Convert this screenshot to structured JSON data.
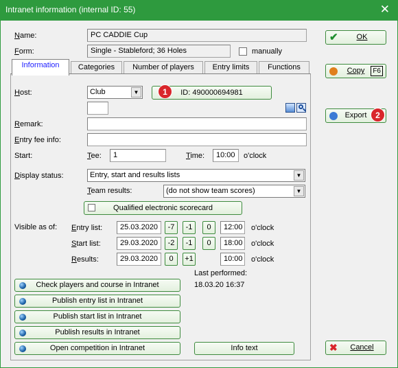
{
  "window": {
    "title": "Intranet information (internal ID: 55)",
    "close_glyph": "✕"
  },
  "header": {
    "name_label": "Name:",
    "name_value": "PC CADDIE Cup",
    "form_label": "Form:",
    "form_value": "Single - Stableford; 36 Holes",
    "manually_label": "manually"
  },
  "tabs": [
    "Information",
    "Categories",
    "Number of players",
    "Entry limits",
    "Functions"
  ],
  "info": {
    "host_label": "Host:",
    "host_value": "Club",
    "id_button": "ID: 490000694981",
    "remark_label": "Remark:",
    "entry_fee_label": "Entry fee info:",
    "start_label": "Start:",
    "tee_label": "Tee:",
    "tee_value": "1",
    "time_label": "Time:",
    "time_value": "10:00",
    "oclock": "o'clock",
    "display_status_label": "Display status:",
    "display_status_value": "Entry, start and results lists",
    "team_results_label": "Team results:",
    "team_results_value": "(do not show team scores)",
    "qualified_label": "Qualified electronic scorecard",
    "visible_as_of_label": "Visible as of:",
    "entry_list": {
      "label": "Entry list:",
      "date": "25.03.2020",
      "btns": [
        "-7",
        "-1",
        "0"
      ],
      "time": "12:00"
    },
    "start_list": {
      "label": "Start list:",
      "date": "29.03.2020",
      "btns": [
        "-2",
        "-1",
        "0"
      ],
      "time": "18:00"
    },
    "results": {
      "label": "Results:",
      "date": "29.03.2020",
      "btns": [
        "0",
        "+1"
      ],
      "time": "10:00"
    },
    "last_performed_label": "Last performed:",
    "last_performed_value": "18.03.20 16:37",
    "actions": [
      "Check players and course in Intranet",
      "Publish entry list in Intranet",
      "Publish start list in Intranet",
      "Publish results in Intranet",
      "Open competition in Intranet"
    ],
    "info_text": "Info text"
  },
  "side": {
    "ok": "OK",
    "copy": "Copy",
    "copy_key": "F6",
    "export": "Export",
    "cancel": "Cancel"
  },
  "badges": {
    "b1": "1",
    "b2": "2"
  },
  "colors": {
    "title_bar": "#2e9a3e",
    "button_border": "#3d8a3d",
    "badge": "#d9262b",
    "active_tab_text": "#1a1aff"
  }
}
